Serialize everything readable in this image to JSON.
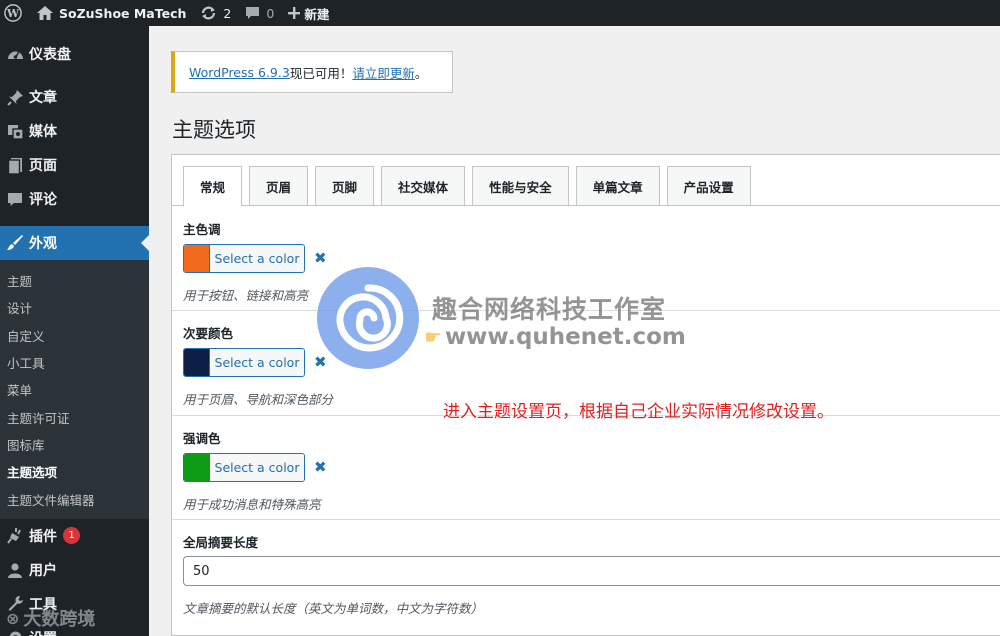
{
  "adminbar": {
    "site_name": "SoZuShoe MaTech",
    "updates_count": "2",
    "comments_count": "0",
    "new_label": "新建"
  },
  "sidebar": {
    "items": [
      {
        "label": "仪表盘",
        "icon": "dashboard-icon"
      },
      {
        "label": "文章",
        "icon": "pin-icon"
      },
      {
        "label": "媒体",
        "icon": "media-icon"
      },
      {
        "label": "页面",
        "icon": "page-icon"
      },
      {
        "label": "评论",
        "icon": "comment-icon"
      },
      {
        "label": "外观",
        "icon": "brush-icon"
      },
      {
        "label": "插件",
        "icon": "plugin-icon",
        "badge": "1"
      },
      {
        "label": "用户",
        "icon": "user-icon"
      },
      {
        "label": "工具",
        "icon": "wrench-icon"
      },
      {
        "label": "设置",
        "icon": "settings-icon"
      }
    ],
    "submenu": [
      "主题",
      "设计",
      "自定义",
      "小工具",
      "菜单",
      "主题许可证",
      "图标库",
      "主题选项",
      "主题文件编辑器"
    ]
  },
  "notice": {
    "link": "WordPress 6.9.3",
    "text": " 现已可用！",
    "action": "请立即更新",
    "end": "。"
  },
  "page_title": "主题选项",
  "tabs": [
    "常规",
    "页眉",
    "页脚",
    "社交媒体",
    "性能与安全",
    "单篇文章",
    "产品设置"
  ],
  "fields": {
    "primary": {
      "label": "主色调",
      "button": "Select a color",
      "color": "#f26b1d",
      "help": "用于按钮、链接和高亮"
    },
    "secondary": {
      "label": "次要颜色",
      "button": "Select a color",
      "color": "#0d1f45",
      "help": "用于页眉、导航和深色部分"
    },
    "accent": {
      "label": "强调色",
      "button": "Select a color",
      "color": "#0e9b16",
      "help": "用于成功消息和特殊高亮"
    },
    "excerpt": {
      "label": "全局摘要长度",
      "value": "50",
      "help": "文章摘要的默认长度（英文为单词数，中文为字符数）"
    }
  },
  "overlay": {
    "watermark_title": "趣合网络科技工作室",
    "watermark_url": "www.quhenet.com",
    "note": "进入主题设置页，根据自己企业实际情况修改设置。",
    "corner": "大数跨境"
  },
  "colors": {
    "accent_blue": "#2271b1",
    "admin_dark": "#1d2327",
    "notice_border": "#dba617",
    "badge_red": "#d63638"
  }
}
